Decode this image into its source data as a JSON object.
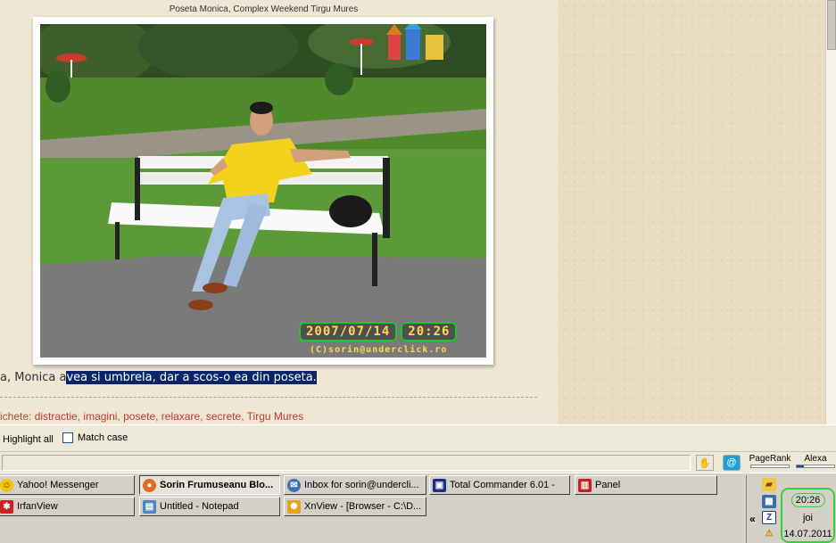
{
  "page": {
    "photo_caption": "Poseta Monica, Complex Weekend Tirgu Mures",
    "photo_stamp_date": "2007/07/14",
    "photo_stamp_time": "20:26",
    "photo_credit": "(C)sorin@underclick.ro",
    "text_before": "a, Monica a",
    "text_selected": "vea si umbrela, dar a scos-o ea din poseta.",
    "tags_label": "ichete:",
    "tags": [
      "distractie",
      "imagini",
      "posete",
      "relaxare",
      "secrete",
      "Tirgu Mures"
    ]
  },
  "findbar": {
    "highlight_all": "Highlight all",
    "match_case": "Match case"
  },
  "statusbar": {
    "pagerank_label": "PageRank",
    "alexa_label": "Alexa"
  },
  "taskbar": {
    "row1": [
      {
        "label": "Yahoo! Messenger",
        "icon": "yahoo-icon",
        "color": "#f5c400"
      },
      {
        "label": "Sorin Frumuseanu Blo...",
        "icon": "firefox-icon",
        "color": "#e06a1b",
        "active": true
      },
      {
        "label": "Inbox for sorin@undercli...",
        "icon": "thunderbird-icon",
        "color": "#3b6fb6"
      },
      {
        "label": "Total Commander 6.01 -",
        "icon": "floppy-icon",
        "color": "#1a2f8a"
      },
      {
        "label": "Panel",
        "icon": "panel-icon",
        "color": "#c0241c"
      }
    ],
    "row2": [
      {
        "label": "IrfanView",
        "icon": "irfanview-icon",
        "color": "#d21e1e"
      },
      {
        "label": "Untitled - Notepad",
        "icon": "notepad-icon",
        "color": "#4f86c6"
      },
      {
        "label": "XnView - [Browser - C:\\D...",
        "icon": "xnview-icon",
        "color": "#e8a020"
      }
    ]
  },
  "tray": {
    "time": "20:26",
    "day": "joi",
    "date": "14.07.2011"
  }
}
